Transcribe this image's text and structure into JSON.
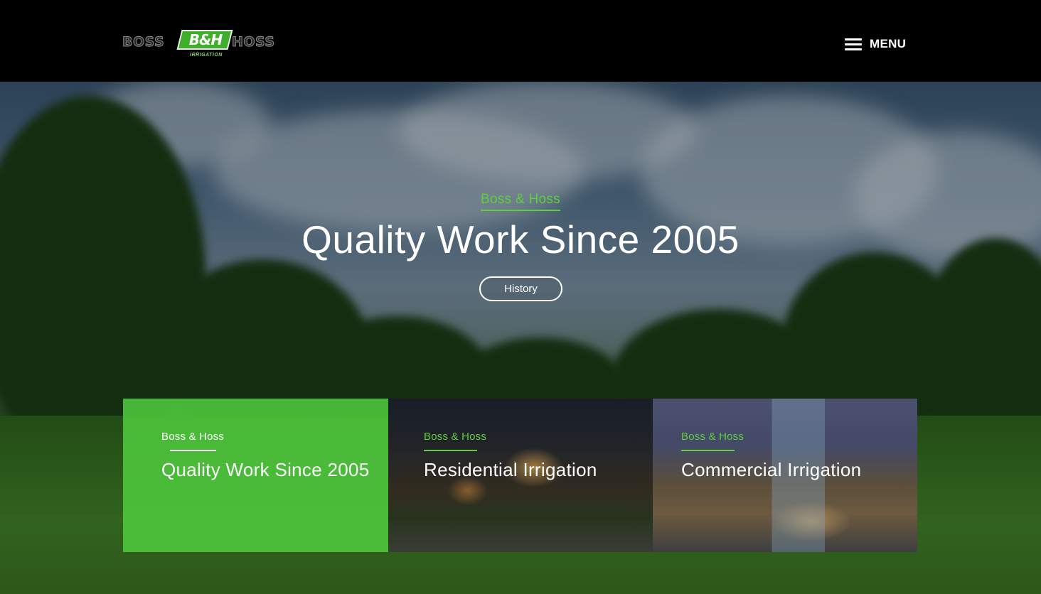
{
  "brand": {
    "logo_left": "BOSS",
    "logo_badge": "B&H",
    "logo_right": "HOSS",
    "logo_sub": "IRRIGATION",
    "accent_color": "#5fcf3f"
  },
  "header": {
    "menu_label": "MENU",
    "menu_icon": "hamburger-icon"
  },
  "hero": {
    "eyebrow": "Boss & Hoss",
    "title": "Quality Work Since 2005",
    "button_label": "History"
  },
  "cards": [
    {
      "eyebrow": "Boss & Hoss",
      "title": "Quality Work Since 2005"
    },
    {
      "eyebrow": "Boss & Hoss",
      "title": "Residential Irrigation"
    },
    {
      "eyebrow": "Boss & Hoss",
      "title": "Commercial Irrigation"
    }
  ]
}
